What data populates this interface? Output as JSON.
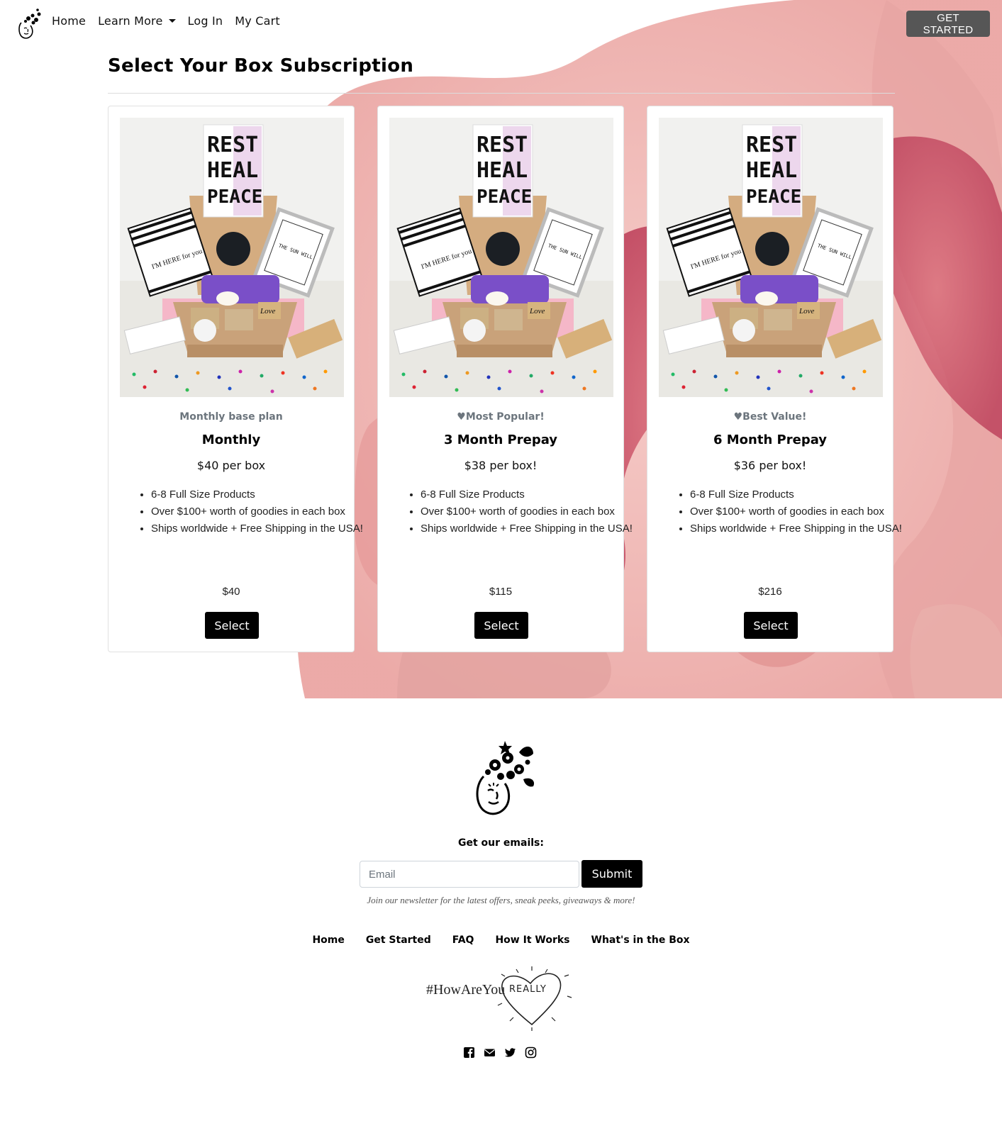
{
  "nav": {
    "links": [
      {
        "label": "Home"
      },
      {
        "label": "Learn More",
        "dropdown": true
      },
      {
        "label": "Log In"
      },
      {
        "label": "My Cart"
      }
    ],
    "cta_label": "GET STARTED"
  },
  "page": {
    "title": "Select Your Box Subscription"
  },
  "plans": [
    {
      "tag": "Monthly base plan",
      "name": "Monthly",
      "price": "$40 per box",
      "features": [
        "6-8 Full Size Products",
        "Over $100+ worth of goodies in each box",
        "Ships worldwide + Free Shipping in the USA!"
      ],
      "total": "$40",
      "button": "Select"
    },
    {
      "tag": "♥Most Popular!",
      "name": "3 Month Prepay",
      "price": "$38 per box!",
      "features": [
        "6-8 Full Size Products",
        "Over $100+ worth of goodies in each box",
        "Ships worldwide + Free Shipping in the USA!"
      ],
      "total": "$115",
      "button": "Select"
    },
    {
      "tag": "♥Best Value!",
      "name": "6 Month Prepay",
      "price": "$36 per box!",
      "features": [
        "6-8 Full Size Products",
        "Over $100+ worth of goodies in each box",
        "Ships worldwide + Free Shipping in the USA!"
      ],
      "total": "$216",
      "button": "Select"
    }
  ],
  "product_image": {
    "card_text": [
      "REST",
      "HEAL",
      "PEACE"
    ],
    "sticker_text": "I'M HERE for you",
    "frame_text": "THE SUN WILL RISE AND IT WILL BE A NEW DAY",
    "tag_text": "Love"
  },
  "footer": {
    "emails_label": "Get our emails:",
    "email_placeholder": "Email",
    "submit_label": "Submit",
    "newsletter_note": "Join our newsletter for the latest offers, sneak peeks, giveaways & more!",
    "links": [
      "Home",
      "Get Started",
      "FAQ",
      "How It Works",
      "What's in the Box"
    ],
    "hashtag": "#HowAreYou",
    "hashtag_heart": "REALLY",
    "social_icons": [
      "facebook-icon",
      "email-icon",
      "twitter-icon",
      "instagram-icon"
    ]
  },
  "colors": {
    "button_dark": "#000000",
    "cta_gray": "#565656",
    "watercolor": "#e8a0a0",
    "muted_text": "#6c757d"
  }
}
